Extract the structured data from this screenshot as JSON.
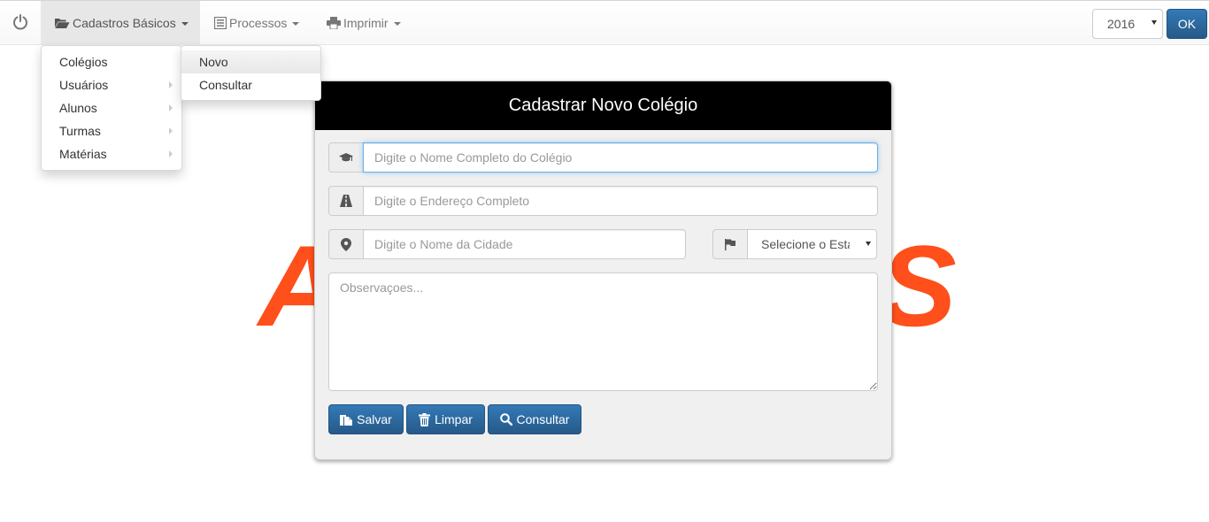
{
  "navbar": {
    "power_icon": "power-icon",
    "menus": [
      {
        "label": "Cadastros Básicos",
        "icon": "folder-open-icon"
      },
      {
        "label": "Processos",
        "icon": "list-alt-icon"
      },
      {
        "label": "Imprimir",
        "icon": "print-icon"
      }
    ],
    "year": "2016",
    "ok_label": "OK"
  },
  "dropdown": {
    "items": [
      {
        "label": "Colégios",
        "has_submenu": false
      },
      {
        "label": "Usuários",
        "has_submenu": true
      },
      {
        "label": "Alunos",
        "has_submenu": true
      },
      {
        "label": "Turmas",
        "has_submenu": true
      },
      {
        "label": "Matérias",
        "has_submenu": true
      }
    ],
    "submenu": [
      {
        "label": "Novo",
        "active": true
      },
      {
        "label": "Consultar",
        "active": false
      }
    ]
  },
  "background_logo": {
    "left_letter": "A",
    "right_letter": "S",
    "color": "#ff4f1a"
  },
  "form": {
    "title": "Cadastrar Novo Colégio",
    "name_placeholder": "Digite o Nome Completo do Colégio",
    "address_placeholder": "Digite o Endereço Completo",
    "city_placeholder": "Digite o Nome da Cidade",
    "state_select": "Selecione o Estado",
    "notes_placeholder": "Observaçoes...",
    "buttons": {
      "save": "Salvar",
      "clear": "Limpar",
      "search": "Consultar"
    }
  },
  "colors": {
    "primary": "#337ab7",
    "header": "#000000",
    "accent": "#ff4f1a"
  }
}
